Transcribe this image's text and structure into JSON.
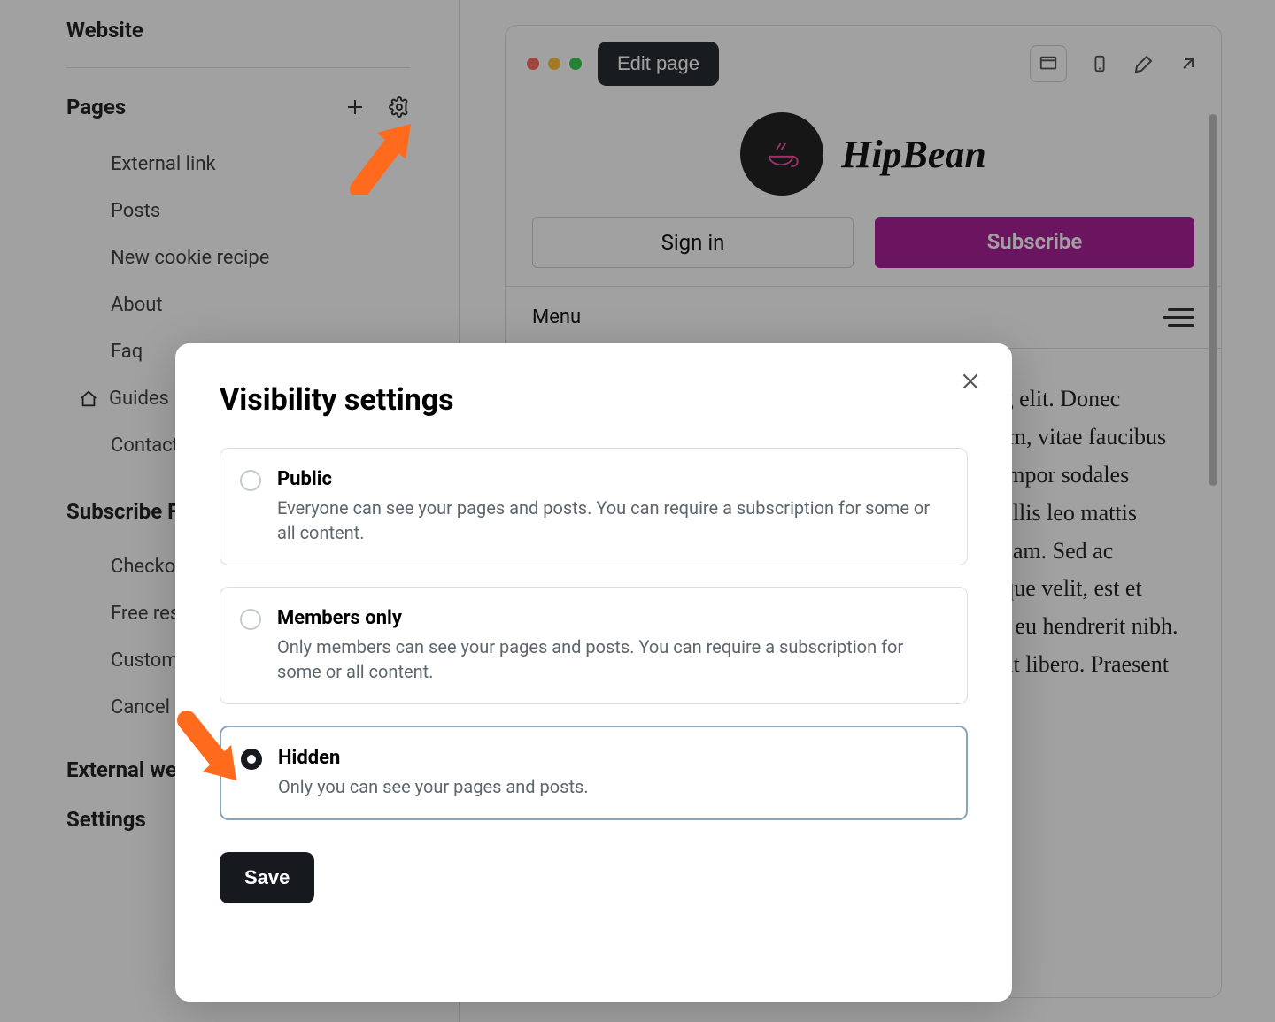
{
  "sidebar": {
    "title": "Website",
    "pages_label": "Pages",
    "pages": [
      "External link",
      "Posts",
      "New cookie recipe",
      "About",
      "Faq",
      "Guides",
      "Contact"
    ],
    "subscribe_label": "Subscribe Forms",
    "forms": [
      "Checkout",
      "Free resource",
      "Custom",
      "Cancel"
    ],
    "external_label": "External website",
    "settings_label": "Settings"
  },
  "preview": {
    "edit_page": "Edit page",
    "brand_name": "HipBean",
    "signin": "Sign in",
    "subscribe": "Subscribe",
    "menu_label": "Menu",
    "article": "Lorem ipsum dolor sit amet, consectetur adipiscing elit. Donec pretium, velit vel interdum varius, nunc laoreet enim, vitae faucibus lacus tortor eget aliquet, orci fermentum vitae at tempor sodales magna ut dolor. Nunc viverra sed metus, nec convallis leo mattis justo. Etiam neque lectus, rutrum non diam at aliquam. Sed ac consectetur ac commodo leo felis, auctor sed tristique velit, est et tellus, maximus quis. Vestibulum quis egestas. Sed eu hendrerit nibh. Integer porta accumsan eu mauris. Aenean tincidunt libero. Praesent vulputate orci."
  },
  "modal": {
    "title": "Visibility settings",
    "options": [
      {
        "title": "Public",
        "desc": "Everyone can see your pages and posts. You can require a subscription for some or all content."
      },
      {
        "title": "Members only",
        "desc": "Only members can see your pages and posts. You can require a subscription for some or all content."
      },
      {
        "title": "Hidden",
        "desc": "Only you can see your pages and posts."
      }
    ],
    "selected": 2,
    "save_label": "Save"
  },
  "colors": {
    "accent": "#a30f8f",
    "arrow": "#ff6a1c"
  }
}
